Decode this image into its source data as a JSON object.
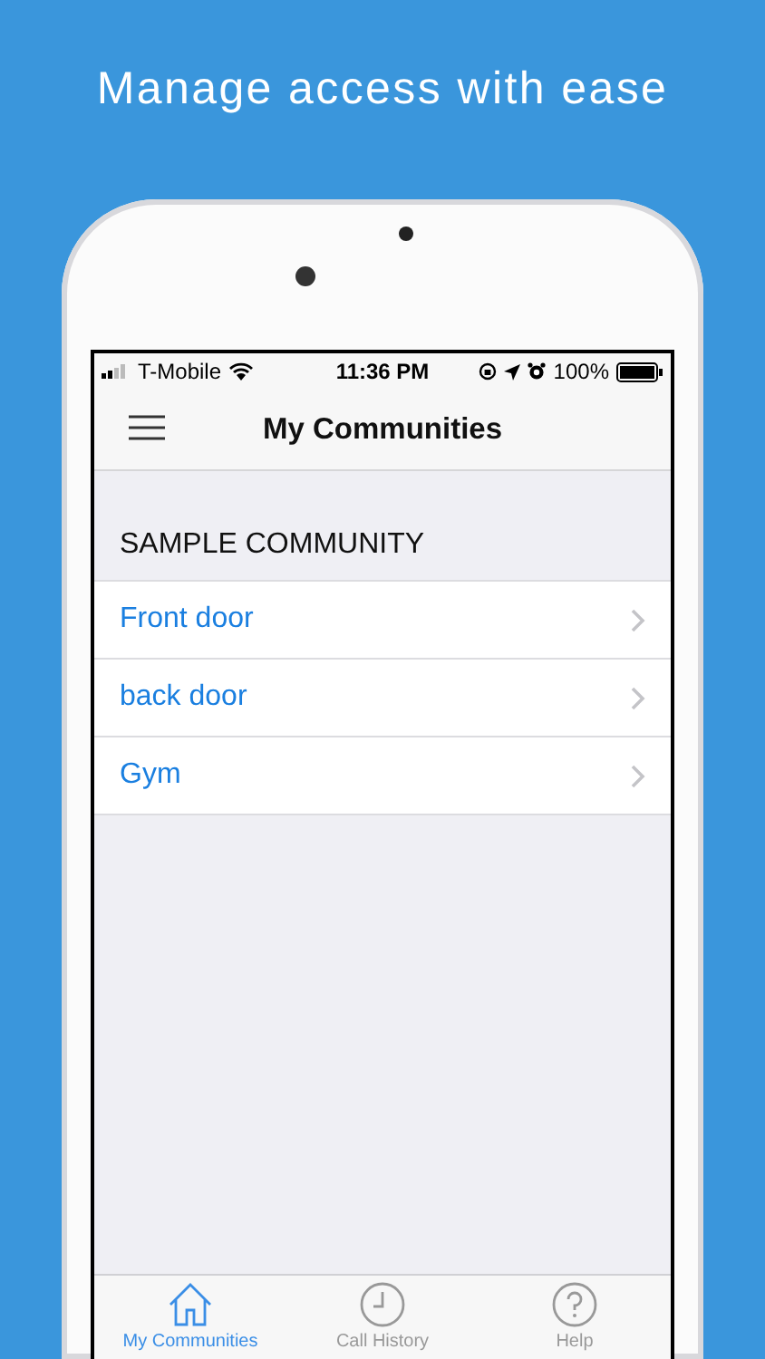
{
  "headline": "Manage access with ease",
  "status_bar": {
    "carrier": "T-Mobile",
    "time": "11:36 PM",
    "battery": "100%"
  },
  "nav": {
    "title": "My Communities"
  },
  "section": {
    "title": "SAMPLE COMMUNITY",
    "rows": [
      {
        "label": "Front door"
      },
      {
        "label": "back door"
      },
      {
        "label": "Gym"
      }
    ]
  },
  "tabs": [
    {
      "kind": "home",
      "label": "My Communities",
      "selected": true
    },
    {
      "kind": "history",
      "label": "Call History",
      "selected": false
    },
    {
      "kind": "help",
      "label": "Help",
      "selected": false
    }
  ]
}
